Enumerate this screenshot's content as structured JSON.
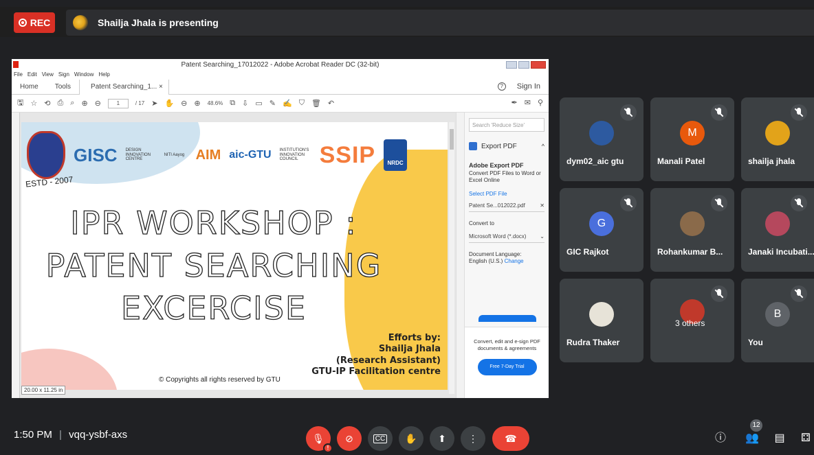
{
  "meeting": {
    "rec_label": "REC",
    "presenting_text": "Shailja Jhala is presenting",
    "time": "1:50 PM",
    "separator": "|",
    "code": "vqq-ysbf-axs",
    "participants_count": "12"
  },
  "acrobat": {
    "window_title": "Patent Searching_17012022 - Adobe Acrobat Reader DC (32-bit)",
    "menu": [
      "File",
      "Edit",
      "View",
      "Sign",
      "Window",
      "Help"
    ],
    "tabs": {
      "home": "Home",
      "tools": "Tools",
      "doc": "Patent Searching_1...  ×"
    },
    "sign_in": "Sign In",
    "page_current": "1",
    "page_total": "/ 17",
    "zoom": "48.6%",
    "side": {
      "search_placeholder": "Search 'Reduce Size'",
      "export_label": "Export PDF",
      "section_title": "Adobe Export PDF",
      "section_desc": "Convert PDF Files to Word or Excel Online",
      "select_file": "Select PDF File",
      "file_name": "Patent Se...012022.pdf",
      "convert_to_label": "Convert to",
      "convert_to_value": "Microsoft Word (*.docx)",
      "doc_lang_label": "Document Language:",
      "doc_lang_value": "English (U.S.)",
      "change_link": "Change",
      "promo": "Convert, edit and e-sign PDF documents & agreements",
      "trial_button": "Free 7-Day Trial"
    },
    "size_tag": "20.00 x 11.25 in"
  },
  "slide": {
    "estd": "ESTD - 2007",
    "logos": {
      "gisc": "GISC",
      "aim": "AIM",
      "aic": "aic-GTU",
      "ssip": "SSIP",
      "nrdc": "NRDC",
      "design": "DESIGN INNOVATION CENTRE",
      "niti": "NITI Aayog",
      "iic": "INSTITUTION'S INNOVATION COUNCIL"
    },
    "title_line1": "IPR WORKSHOP :",
    "title_line2": "PATENT SEARCHING",
    "title_line3": "EXCERCISE",
    "efforts_1": "Efforts by:",
    "efforts_2": "Shailja Jhala",
    "efforts_3": "(Research Assistant)",
    "efforts_4": "GTU-IP Facilitation centre",
    "copyright": "© Copyrights all rights reserved by GTU"
  },
  "participants": [
    {
      "name": "dym02_aic gtu",
      "avatar": "photo",
      "color": "#2d5aa0"
    },
    {
      "name": "Manali Patel",
      "avatar": "M",
      "color": "#e8590c"
    },
    {
      "name": "shailja jhala",
      "avatar": "photo",
      "color": "#e2a31a"
    },
    {
      "name": "GIC Rajkot",
      "avatar": "G",
      "color": "#4a6fdc"
    },
    {
      "name": "Rohankumar B...",
      "avatar": "photo",
      "color": "#8a6a4a"
    },
    {
      "name": "Janaki Incubati...",
      "avatar": "photo",
      "color": "#b5485d"
    },
    {
      "name": "Rudra Thaker",
      "avatar": "photo",
      "color": "#e7e3d8"
    },
    {
      "name": "3 others",
      "avatar": "photo",
      "color": "#c0392b"
    },
    {
      "name": "You",
      "avatar": "B",
      "color": "#5f6368"
    }
  ]
}
